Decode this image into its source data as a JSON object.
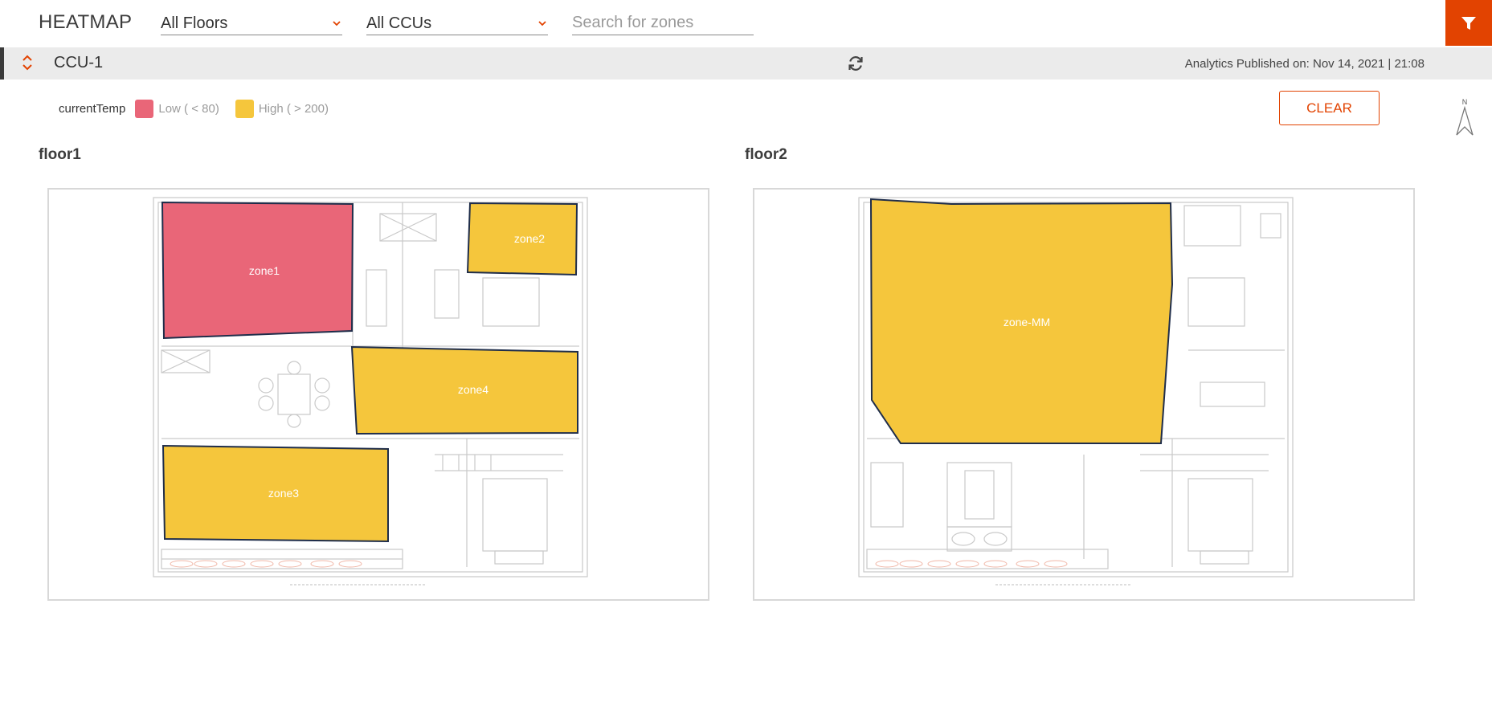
{
  "header": {
    "title": "HEATMAP",
    "floor_select": "All Floors",
    "ccu_select": "All CCUs",
    "search_placeholder": "Search for zones"
  },
  "ccu_bar": {
    "name": "CCU-1",
    "published": "Analytics Published on: Nov 14, 2021 | 21:08"
  },
  "legend": {
    "title": "currentTemp",
    "items": [
      {
        "label": "Low ( < 80)",
        "color": "#e96678"
      },
      {
        "label": "High ( > 200)",
        "color": "#f5c63c"
      }
    ]
  },
  "clear_label": "CLEAR",
  "compass_label": "N",
  "colors": {
    "accent": "#e24301",
    "low": "#e96678",
    "high": "#f5c63c",
    "zone_border": "#1f2d4a"
  },
  "floors": [
    {
      "name": "floor1",
      "zones": [
        {
          "label": "zone1",
          "level": "low"
        },
        {
          "label": "zone2",
          "level": "high"
        },
        {
          "label": "zone4",
          "level": "high"
        },
        {
          "label": "zone3",
          "level": "high"
        }
      ]
    },
    {
      "name": "floor2",
      "zones": [
        {
          "label": "zone-MM",
          "level": "high"
        }
      ]
    }
  ]
}
